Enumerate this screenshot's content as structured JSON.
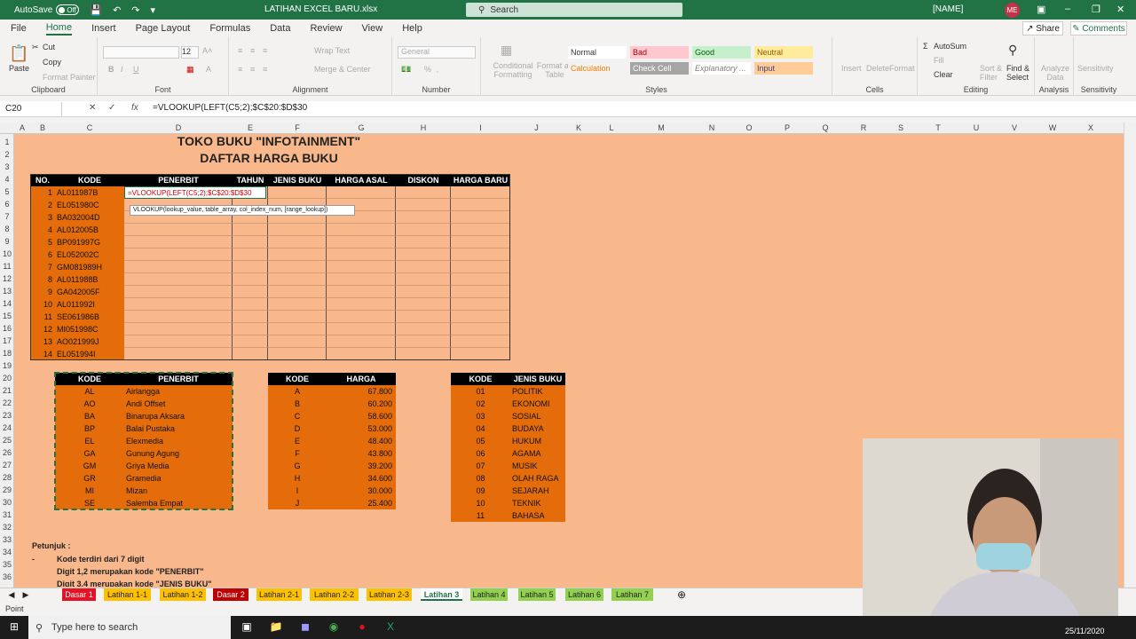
{
  "titlebar": {
    "autosave_label": "AutoSave",
    "autosave_state": "Off",
    "doc_title": "LATIHAN EXCEL BARU.xlsx",
    "search_placeholder": "Search",
    "user_name": "[NAME]",
    "user_initials": "ME"
  },
  "menu": [
    "File",
    "Home",
    "Insert",
    "Page Layout",
    "Formulas",
    "Data",
    "Review",
    "View",
    "Help"
  ],
  "share_label": "Share",
  "comments_label": "Comments",
  "ribbon": {
    "clipboard": {
      "paste": "Paste",
      "cut": "Cut",
      "copy": "Copy",
      "format_painter": "Format Painter",
      "label": "Clipboard"
    },
    "font": {
      "label": "Font",
      "size": "12"
    },
    "alignment": {
      "wrap": "Wrap Text",
      "merge": "Merge & Center",
      "label": "Alignment"
    },
    "number": {
      "format": "General",
      "label": "Number"
    },
    "styles": {
      "cf": "Conditional Formatting",
      "fat": "Format as Table",
      "label": "Styles",
      "normal": "Normal",
      "bad": "Bad",
      "good": "Good",
      "neutral": "Neutral",
      "calculation": "Calculation",
      "check_cell": "Check Cell",
      "explanatory": "Explanatory ...",
      "input": "Input"
    },
    "cells": {
      "insert": "Insert",
      "delete": "Delete",
      "format": "Format",
      "label": "Cells"
    },
    "editing": {
      "autosum": "AutoSum",
      "fill": "Fill",
      "clear": "Clear",
      "sort": "Sort & Filter",
      "find": "Find & Select",
      "label": "Editing"
    },
    "analysis": {
      "analyze": "Analyze Data",
      "label": "Analysis"
    },
    "sensitivity": {
      "label": "Sensitivity"
    }
  },
  "formula_bar": {
    "name_box": "C20",
    "formula": "=VLOOKUP(LEFT(C5;2);$C$20:$D$30"
  },
  "columns": [
    "A",
    "B",
    "C",
    "D",
    "E",
    "F",
    "G",
    "H",
    "I",
    "J",
    "K",
    "L",
    "M",
    "N",
    "O",
    "P",
    "Q",
    "R",
    "S",
    "T",
    "U",
    "V",
    "W",
    "X"
  ],
  "rows": [
    "1",
    "2",
    "3",
    "4",
    "5",
    "6",
    "7",
    "8",
    "9",
    "10",
    "11",
    "12",
    "13",
    "14",
    "15",
    "16",
    "17",
    "18",
    "19",
    "20",
    "21",
    "22",
    "23",
    "24",
    "25",
    "26",
    "27",
    "28",
    "29",
    "30",
    "31",
    "32",
    "33",
    "34",
    "35",
    "36"
  ],
  "sheet_title1": "TOKO BUKU \"INFOTAINMENT\"",
  "sheet_title2": "DAFTAR HARGA BUKU",
  "main_headers": [
    "NO.",
    "KODE",
    "PENERBIT",
    "TAHUN",
    "JENIS BUKU",
    "HARGA ASAL",
    "DISKON",
    "HARGA BARU"
  ],
  "main_rows": [
    {
      "no": "1",
      "kode": "AL011987B"
    },
    {
      "no": "2",
      "kode": "EL051980C"
    },
    {
      "no": "3",
      "kode": "BA032004D"
    },
    {
      "no": "4",
      "kode": "AL012005B"
    },
    {
      "no": "5",
      "kode": "BP091997G"
    },
    {
      "no": "6",
      "kode": "EL052002C"
    },
    {
      "no": "7",
      "kode": "GM081989H"
    },
    {
      "no": "8",
      "kode": "AL011988B"
    },
    {
      "no": "9",
      "kode": "GA042005F"
    },
    {
      "no": "10",
      "kode": "AL011992I"
    },
    {
      "no": "11",
      "kode": "SE061986B"
    },
    {
      "no": "12",
      "kode": "MI051998C"
    },
    {
      "no": "13",
      "kode": "AO021999J"
    },
    {
      "no": "14",
      "kode": "EL051994I"
    }
  ],
  "edit_formula": "=VLOOKUP(LEFT(C5;2);$C$20:$D$30",
  "tooltip": "VLOOKUP(lookup_value, table_array, col_index_num, [range_lookup])",
  "penerbit_table": {
    "headers": [
      "KODE",
      "PENERBIT"
    ],
    "rows": [
      [
        "AL",
        "Airlangga"
      ],
      [
        "AO",
        "Andi Offset"
      ],
      [
        "BA",
        "Binarupa Aksara"
      ],
      [
        "BP",
        "Balai Pustaka"
      ],
      [
        "EL",
        "Elexmedia"
      ],
      [
        "GA",
        "Gunung Agung"
      ],
      [
        "GM",
        "Griya Media"
      ],
      [
        "GR",
        "Gramedia"
      ],
      [
        "MI",
        "Mizan"
      ],
      [
        "SE",
        "Salemba Empat"
      ]
    ]
  },
  "harga_table": {
    "headers": [
      "KODE",
      "HARGA"
    ],
    "rows": [
      [
        "A",
        "67.800"
      ],
      [
        "B",
        "60.200"
      ],
      [
        "C",
        "58.600"
      ],
      [
        "D",
        "53.000"
      ],
      [
        "E",
        "48.400"
      ],
      [
        "F",
        "43.800"
      ],
      [
        "G",
        "39.200"
      ],
      [
        "H",
        "34.600"
      ],
      [
        "I",
        "30.000"
      ],
      [
        "J",
        "25.400"
      ]
    ]
  },
  "jenis_table": {
    "headers": [
      "KODE",
      "JENIS BUKU"
    ],
    "rows": [
      [
        "01",
        "POLITIK"
      ],
      [
        "02",
        "EKONOMI"
      ],
      [
        "03",
        "SOSIAL"
      ],
      [
        "04",
        "BUDAYA"
      ],
      [
        "05",
        "HUKUM"
      ],
      [
        "06",
        "AGAMA"
      ],
      [
        "07",
        "MUSIK"
      ],
      [
        "08",
        "OLAH RAGA"
      ],
      [
        "09",
        "SEJARAH"
      ],
      [
        "10",
        "TEKNIK"
      ],
      [
        "11",
        "BAHASA"
      ]
    ]
  },
  "notes": {
    "title": "Petunjuk :",
    "bullet": "-",
    "line1": "Kode terdiri dari 7 digit",
    "line2": "Digit 1,2 merupakan kode \"PENERBIT\"",
    "line3": "Digit 3,4 merupakan kode \"JENIS BUKU\""
  },
  "tabs": [
    {
      "name": "Dasar 1",
      "color": "#e81123",
      "text": "#ffffff"
    },
    {
      "name": "Latihan 1-1",
      "color": "#ffc000",
      "text": "#222222"
    },
    {
      "name": "Latihan 1-2",
      "color": "#ffc000",
      "text": "#222222"
    },
    {
      "name": "Dasar 2",
      "color": "#c00000",
      "text": "#ffffff"
    },
    {
      "name": "Latihan 2-1",
      "color": "#ffc000",
      "text": "#222222"
    },
    {
      "name": "Latihan 2-2",
      "color": "#ffc000",
      "text": "#222222"
    },
    {
      "name": "Latihan 2-3",
      "color": "#ffc000",
      "text": "#222222"
    },
    {
      "name": "Latihan 3",
      "color": "#ffffff",
      "text": "#217346"
    },
    {
      "name": "Latihan 4",
      "color": "#92d050",
      "text": "#222222"
    },
    {
      "name": "Latihan 5",
      "color": "#92d050",
      "text": "#222222"
    },
    {
      "name": "Latihan 6",
      "color": "#92d050",
      "text": "#222222"
    },
    {
      "name": "Latihan 7",
      "color": "#92d050",
      "text": "#222222"
    }
  ],
  "status": "Point",
  "taskbar": {
    "search": "Type here to search",
    "date": "25/11/2020"
  },
  "colors": {
    "accent": "#217346",
    "sheet_bg": "#f8b88b",
    "cell_orange": "#e46c0a",
    "header_black": "#000000"
  }
}
